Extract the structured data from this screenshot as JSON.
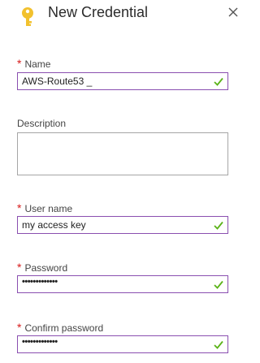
{
  "header": {
    "title": "New Credential"
  },
  "fields": {
    "name": {
      "label": "Name",
      "value": "AWS-Route53 _",
      "required": "*"
    },
    "description": {
      "label": "Description",
      "value": ""
    },
    "username": {
      "label": "User name",
      "value": "my access key",
      "required": "*"
    },
    "password": {
      "label": "Password",
      "value": "•••••••••••••",
      "required": "*"
    },
    "confirm": {
      "label": "Confirm password",
      "value": "•••••••••••••",
      "required": "*"
    }
  },
  "colors": {
    "accent": "#8a4fb0",
    "valid": "#5bb318",
    "required": "#d61a1a",
    "key": "#f2c12e"
  },
  "icons": {
    "header": "key-icon",
    "close": "close-icon",
    "valid": "check-icon"
  }
}
